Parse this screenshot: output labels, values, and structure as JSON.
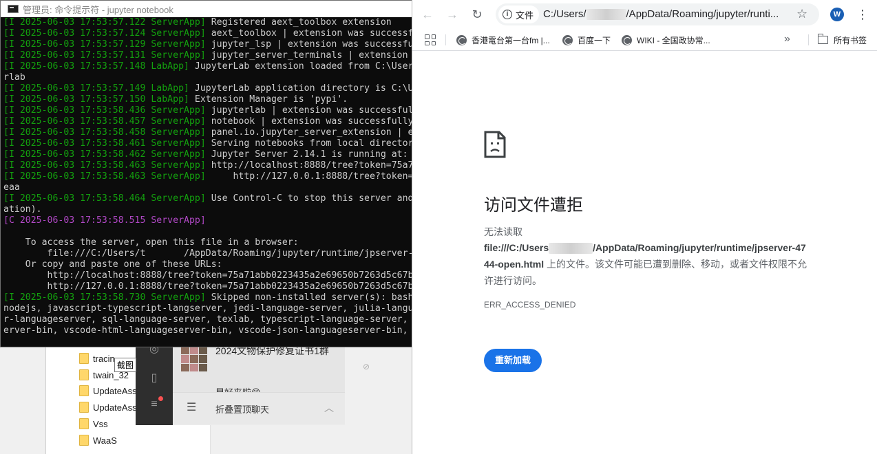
{
  "explorer": {
    "folders": [
      "tracin",
      "twain_32",
      "UpdateAss",
      "UpdateAss",
      "Vss",
      "WaaS"
    ],
    "tooltip": "截图"
  },
  "chat": {
    "group_name": "2024文物保护修复证书1群",
    "preview": "早好来啦😊",
    "fold_label": "折叠置顶聊天"
  },
  "terminal": {
    "title": "管理员: 命令提示符 - jupyter  notebook",
    "lines": [
      {
        "prefix": "[I 2025-06-03 17:53:57.122 ServerApp]",
        "kind": "i",
        "text": " Registered aext_toolbox extension"
      },
      {
        "prefix": "[I 2025-06-03 17:53:57.124 ServerApp]",
        "kind": "i",
        "text": " aext_toolbox | extension was successful"
      },
      {
        "prefix": "[I 2025-06-03 17:53:57.129 ServerApp]",
        "kind": "i",
        "text": " jupyter_lsp | extension was successfull"
      },
      {
        "prefix": "[I 2025-06-03 17:53:57.131 ServerApp]",
        "kind": "i",
        "text": " jupyter_server_terminals | extension wa"
      },
      {
        "prefix": "[I 2025-06-03 17:53:57.148 LabApp]",
        "kind": "i",
        "text": " JupyterLab extension loaded from C:\\User"
      },
      {
        "prefix": "",
        "kind": "",
        "text": "rlab"
      },
      {
        "prefix": "[I 2025-06-03 17:53:57.149 LabApp]",
        "kind": "i",
        "text": " JupyterLab application directory is C:\\U"
      },
      {
        "prefix": "[I 2025-06-03 17:53:57.150 LabApp]",
        "kind": "i",
        "text": " Extension Manager is 'pypi'."
      },
      {
        "prefix": "[I 2025-06-03 17:53:58.436 ServerApp]",
        "kind": "i",
        "text": " jupyterlab | extension was successfully"
      },
      {
        "prefix": "[I 2025-06-03 17:53:58.457 ServerApp]",
        "kind": "i",
        "text": " notebook | extension was successfully l"
      },
      {
        "prefix": "[I 2025-06-03 17:53:58.458 ServerApp]",
        "kind": "i",
        "text": " panel.io.jupyter_server_extension | ext"
      },
      {
        "prefix": "[I 2025-06-03 17:53:58.461 ServerApp]",
        "kind": "i",
        "text": " Serving notebooks from local directory"
      },
      {
        "prefix": "[I 2025-06-03 17:53:58.462 ServerApp]",
        "kind": "i",
        "text": " Jupyter Server 2.14.1 is running at:"
      },
      {
        "prefix": "[I 2025-06-03 17:53:58.463 ServerApp]",
        "kind": "i",
        "text": " http://localhost:8888/tree?token=75a71a"
      },
      {
        "prefix": "[I 2025-06-03 17:53:58.463 ServerApp]",
        "kind": "i",
        "text": "     http://127.0.0.1:8888/tree?token=7"
      },
      {
        "prefix": "",
        "kind": "",
        "text": "eaa"
      },
      {
        "prefix": "[I 2025-06-03 17:53:58.464 ServerApp]",
        "kind": "i",
        "text": " Use Control-C to stop this server and s"
      },
      {
        "prefix": "",
        "kind": "",
        "text": "ation)."
      },
      {
        "prefix": "[C 2025-06-03 17:53:58.515 ServerApp]",
        "kind": "c",
        "text": ""
      },
      {
        "prefix": "",
        "kind": "",
        "text": ""
      },
      {
        "prefix": "",
        "kind": "",
        "text": "    To access the server, open this file in a browser:"
      },
      {
        "prefix": "",
        "kind": "",
        "text": "        file:///C:/Users/t       /AppData/Roaming/jupyter/runtime/jpserver-"
      },
      {
        "prefix": "",
        "kind": "",
        "text": "    Or copy and paste one of these URLs:"
      },
      {
        "prefix": "",
        "kind": "",
        "text": "        http://localhost:8888/tree?token=75a71abb0223435a2e69650b7263d5c67b"
      },
      {
        "prefix": "",
        "kind": "",
        "text": "        http://127.0.0.1:8888/tree?token=75a71abb0223435a2e69650b7263d5c67b"
      },
      {
        "prefix": "[I 2025-06-03 17:53:58.730 ServerApp]",
        "kind": "i",
        "text": " Skipped non-installed server(s): bash-l"
      },
      {
        "prefix": "",
        "kind": "",
        "text": "nodejs, javascript-typescript-langserver, jedi-language-server, julia-langua"
      },
      {
        "prefix": "",
        "kind": "",
        "text": "r-languageserver, sql-language-server, texlab, typescript-language-server, u"
      },
      {
        "prefix": "",
        "kind": "",
        "text": "erver-bin, vscode-html-languageserver-bin, vscode-json-languageserver-bin, y"
      }
    ]
  },
  "browser": {
    "omnibox": {
      "chip_label": "文件",
      "url_start": "C:/Users/",
      "url_end": "/AppData/Roaming/jupyter/runti..."
    },
    "profile_initial": "W",
    "bookmarks": [
      "香港電台第一台fm |...",
      "百度一下",
      "WIKI - 全国政协常..."
    ],
    "all_bookmarks_label": "所有书签",
    "error": {
      "title": "访问文件遭拒",
      "line1": "无法读取",
      "path_start": "file:///C:/Users",
      "path_end": "/AppData/Roaming/jupyter/runtime/jpserver-4744-open.html",
      "message": " 上的文件。该文件可能已遭到删除、移动，或者文件权限不允许进行访问。",
      "code": "ERR_ACCESS_DENIED",
      "reload_label": "重新加载"
    }
  },
  "colors": {
    "terminal_bg": "#0c0c0c",
    "terminal_info": "#13a10e",
    "terminal_critical": "#b148c6",
    "accent_blue": "#1a73e8"
  }
}
